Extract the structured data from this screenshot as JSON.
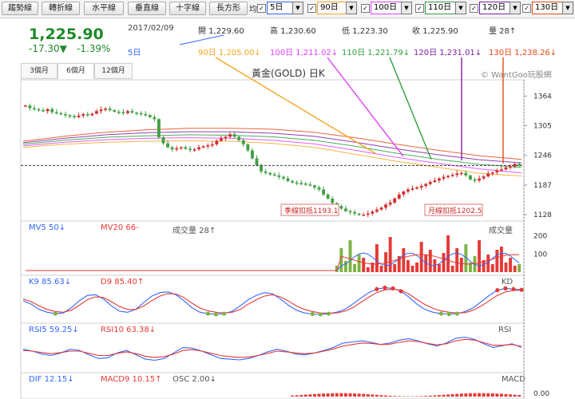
{
  "toolbar": {
    "buttons": [
      "趨勢線",
      "轉折線",
      "水平線",
      "垂直線",
      "十字線",
      "長方形"
    ],
    "ma_label": "均",
    "ma_controls": [
      {
        "value": "5日",
        "color": "#3366ff"
      },
      {
        "value": "90日",
        "color": "#f5a623"
      },
      {
        "value": "100日",
        "color": "#e040fb"
      },
      {
        "value": "110日",
        "color": "#2e9e3e"
      },
      {
        "value": "120日",
        "color": "#7b1fa2"
      },
      {
        "value": "130日",
        "color": "#e64a19"
      }
    ]
  },
  "quote": {
    "price": "1,225.90",
    "change": "-17.30▼",
    "change_pct": "-1.39%",
    "date": "2017/02/09",
    "open": "開 1,229.60",
    "high": "高 1,230.60",
    "low": "低 1,223.30",
    "close": "收 1,225.90",
    "days": "量 28↑"
  },
  "ma_values": [
    {
      "label": "5日",
      "color": "#3366ff"
    },
    {
      "label": "90日 1,205.00↓",
      "color": "#f5a623"
    },
    {
      "label": "100日 1,211.02↓",
      "color": "#e040fb"
    },
    {
      "label": "110日 1,221.79↓",
      "color": "#2e9e3e"
    },
    {
      "label": "120日 1,231.01↓",
      "color": "#7b1fa2"
    },
    {
      "label": "130日 1,238.26↓",
      "color": "#e64a19"
    }
  ],
  "tabs": [
    "3個月",
    "6個月",
    "12個月"
  ],
  "chart_title": "黃金(GOLD) 日K",
  "watermark": "© WantGoo玩股網",
  "panel_labels": {
    "volume": [
      {
        "t": "MV5 50↓",
        "c": "#3366ff"
      },
      {
        "t": "MV20 66-",
        "c": "#e53935"
      },
      {
        "t": "成交量 28↑",
        "c": "#555"
      }
    ],
    "volume_right": "成交量",
    "kd": [
      {
        "t": "K9 85.63↓",
        "c": "#3366ff"
      },
      {
        "t": "D9 85.40↑",
        "c": "#e53935"
      }
    ],
    "kd_right": "KD",
    "rsi": [
      {
        "t": "RSI5 59.25↓",
        "c": "#3366ff"
      },
      {
        "t": "RSI10 63.38↓",
        "c": "#e53935"
      }
    ],
    "rsi_right": "RSI",
    "macd": [
      {
        "t": "DIF 12.15↓",
        "c": "#3366ff"
      },
      {
        "t": "MACD9 10.15↑",
        "c": "#e53935"
      },
      {
        "t": "OSC 2.00↓",
        "c": "#555"
      }
    ],
    "macd_right": "MACD"
  },
  "annotations": [
    {
      "text": "季線扣抵1193.1"
    },
    {
      "text": "月線扣抵1202.5"
    }
  ],
  "chart_data": [
    {
      "type": "candlestick",
      "ylim": [
        1120,
        1390
      ],
      "y_ticks": [
        1364,
        1305,
        1246,
        1187,
        1128
      ],
      "current_price": 1225.9,
      "candles": [
        1345,
        1340,
        1338,
        1336,
        1334,
        1338,
        1332,
        1330,
        1328,
        1326,
        1324,
        1322,
        1325,
        1328,
        1326,
        1329,
        1334,
        1337,
        1339,
        1336,
        1333,
        1332,
        1330,
        1334,
        1331,
        1330,
        1328,
        1326,
        1322,
        1318,
        1282,
        1270,
        1262,
        1258,
        1260,
        1262,
        1259,
        1257,
        1258,
        1262,
        1264,
        1266,
        1268,
        1275,
        1280,
        1283,
        1288,
        1283,
        1276,
        1268,
        1256,
        1240,
        1226,
        1214,
        1211,
        1208,
        1206,
        1203,
        1200,
        1195,
        1192,
        1191,
        1190,
        1188,
        1186,
        1182,
        1178,
        1168,
        1160,
        1151,
        1145,
        1140,
        1135,
        1133,
        1130,
        1128,
        1128,
        1130,
        1134,
        1138,
        1142,
        1148,
        1152,
        1160,
        1168,
        1174,
        1178,
        1180,
        1182,
        1185,
        1189,
        1193,
        1196,
        1200,
        1203,
        1205,
        1207,
        1210,
        1211,
        1206,
        1198,
        1196,
        1200,
        1204,
        1210,
        1212,
        1216,
        1218,
        1222,
        1224,
        1229,
        1226
      ],
      "ma_series": [
        {
          "name": "90日",
          "values": [
            1262,
            1268,
            1272,
            1274,
            1275,
            1274,
            1270,
            1262,
            1248,
            1234,
            1222,
            1210,
            1205
          ]
        },
        {
          "name": "100日",
          "values": [
            1265,
            1272,
            1277,
            1280,
            1281,
            1280,
            1276,
            1269,
            1256,
            1242,
            1230,
            1219,
            1211
          ]
        },
        {
          "name": "110日",
          "values": [
            1268,
            1276,
            1282,
            1285,
            1287,
            1286,
            1283,
            1276,
            1264,
            1250,
            1238,
            1228,
            1222
          ]
        },
        {
          "name": "120日",
          "values": [
            1271,
            1280,
            1287,
            1291,
            1293,
            1293,
            1290,
            1284,
            1272,
            1259,
            1247,
            1237,
            1231
          ]
        },
        {
          "name": "130日",
          "values": [
            1274,
            1284,
            1292,
            1297,
            1300,
            1300,
            1298,
            1292,
            1281,
            1268,
            1256,
            1245,
            1238
          ]
        }
      ]
    },
    {
      "type": "bar",
      "title": "成交量",
      "ylim": [
        0,
        220
      ],
      "y_ticks": [
        200,
        100
      ],
      "values": [
        0,
        0,
        0,
        0,
        0,
        0,
        0,
        0,
        0,
        0,
        0,
        0,
        0,
        0,
        0,
        0,
        0,
        0,
        0,
        0,
        0,
        0,
        0,
        0,
        0,
        0,
        0,
        0,
        0,
        0,
        0,
        0,
        0,
        0,
        0,
        0,
        0,
        0,
        0,
        0,
        0,
        0,
        0,
        0,
        0,
        0,
        0,
        0,
        0,
        0,
        0,
        0,
        0,
        0,
        0,
        0,
        0,
        0,
        0,
        0,
        0,
        0,
        0,
        0,
        0,
        0,
        0,
        0,
        0,
        0,
        0,
        0,
        0,
        0,
        0,
        0,
        0,
        0,
        0,
        0,
        0,
        0,
        0,
        0,
        0,
        0,
        0,
        0,
        0,
        0,
        0,
        0,
        0,
        0,
        0,
        0,
        0,
        0,
        0,
        0,
        0,
        0,
        0,
        0,
        0,
        0,
        0,
        0,
        0,
        0,
        0,
        0
      ]
    },
    {
      "type": "line",
      "title": "KD",
      "ylim": [
        0,
        100
      ],
      "series": [
        {
          "name": "K9",
          "values": [
            55,
            45,
            30,
            22,
            18,
            20,
            35,
            55,
            70,
            72,
            60,
            40,
            25,
            22,
            30,
            50,
            68,
            78,
            80,
            72,
            55,
            35,
            22,
            18,
            16,
            18,
            25,
            40,
            58,
            70,
            78,
            75,
            60,
            42,
            28,
            20,
            17,
            16,
            18,
            22,
            30,
            45,
            62,
            78,
            88,
            92,
            90,
            82,
            65,
            45,
            30,
            22,
            18,
            17,
            18,
            24,
            35,
            52,
            70,
            85,
            90,
            88,
            86
          ]
        },
        {
          "name": "D9",
          "values": [
            60,
            52,
            40,
            30,
            24,
            22,
            28,
            42,
            58,
            66,
            64,
            52,
            38,
            30,
            30,
            40,
            55,
            68,
            75,
            74,
            64,
            48,
            34,
            26,
            22,
            20,
            22,
            30,
            45,
            58,
            68,
            72,
            66,
            54,
            40,
            30,
            24,
            20,
            19,
            20,
            25,
            35,
            50,
            65,
            78,
            86,
            88,
            85,
            74,
            58,
            44,
            33,
            26,
            22,
            20,
            21,
            28,
            40,
            55,
            70,
            80,
            84,
            85
          ]
        }
      ]
    },
    {
      "type": "line",
      "title": "RSI",
      "ylim": [
        0,
        100
      ],
      "series": [
        {
          "name": "RSI5",
          "values": [
            55,
            50,
            42,
            38,
            45,
            55,
            52,
            40,
            30,
            32,
            45,
            52,
            40,
            28,
            25,
            30,
            45,
            60,
            58,
            50,
            40,
            30,
            28,
            26,
            30,
            38,
            48,
            55,
            50,
            42,
            40,
            45,
            52,
            60,
            72,
            75,
            78,
            74,
            68,
            72,
            80,
            84,
            78,
            70,
            64,
            72,
            85,
            88,
            82,
            70,
            60,
            65,
            70,
            60
          ]
        },
        {
          "name": "RSI10",
          "values": [
            52,
            50,
            46,
            43,
            46,
            50,
            50,
            44,
            38,
            38,
            44,
            48,
            43,
            36,
            33,
            35,
            42,
            52,
            54,
            50,
            44,
            38,
            35,
            33,
            34,
            38,
            44,
            50,
            48,
            45,
            43,
            45,
            50,
            56,
            64,
            68,
            72,
            71,
            68,
            69,
            74,
            78,
            76,
            71,
            67,
            70,
            78,
            82,
            80,
            73,
            66,
            66,
            68,
            63
          ]
        }
      ]
    },
    {
      "type": "bar",
      "title": "MACD",
      "values": [
        0,
        0,
        0,
        0,
        0,
        0,
        0,
        0,
        0,
        0,
        0,
        0,
        0,
        0,
        0,
        0,
        0,
        0,
        0,
        0,
        0,
        0,
        0,
        0,
        0,
        0,
        0,
        0,
        0,
        0,
        0,
        0,
        0,
        0,
        0,
        0,
        0,
        0,
        0,
        0,
        0,
        0,
        0,
        0,
        0,
        0,
        0,
        0,
        0,
        0,
        0,
        0,
        0,
        0,
        0,
        0,
        0,
        0,
        0,
        0,
        0,
        0,
        0,
        0,
        0,
        0,
        0,
        0,
        0,
        0,
        0,
        0,
        0,
        0,
        0,
        0,
        0,
        0,
        0,
        0,
        0,
        0,
        0,
        0,
        0,
        0,
        0,
        0,
        0,
        0,
        0,
        0,
        0,
        0,
        0,
        0,
        0,
        0,
        0,
        0,
        0,
        0,
        0,
        0,
        0,
        0,
        0,
        0,
        0,
        0,
        0,
        0
      ]
    }
  ]
}
